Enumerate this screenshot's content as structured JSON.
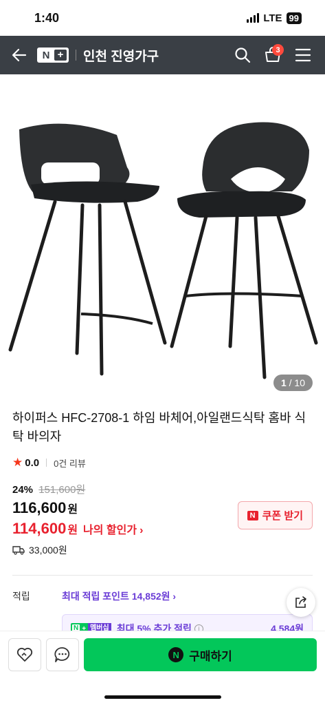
{
  "status_bar": {
    "time": "1:40",
    "network": "LTE",
    "battery": "99"
  },
  "header": {
    "logo_n": "N",
    "logo_plus": "+",
    "store_name": "인천 진영가구",
    "cart_count": "3",
    "icons": [
      "back-arrow-icon",
      "search-icon",
      "cart-icon",
      "menu-icon"
    ]
  },
  "gallery": {
    "current": "1",
    "separator": "/",
    "total": "10"
  },
  "product": {
    "title": "하이퍼스 HFC-2708-1 하임 바체어,아일랜드식탁 홈바 식탁 바의자",
    "rating": "0.0",
    "review_count": "0건 리뷰",
    "discount_rate": "24%",
    "original_price": "151,600원",
    "sale_price": "116,600",
    "won": "원",
    "my_price": "114,600",
    "my_price_label": "나의 할인가",
    "coupon_label": "쿠폰 받기",
    "coupon_badge": "N",
    "delivery_fee": "33,000원"
  },
  "points": {
    "label": "적립",
    "max_points": "최대 적립 포인트 14,852원",
    "membership_badge": "멤버십",
    "membership_text": "최대 5% 추가 적립",
    "membership_amount": "4,584원"
  },
  "bottom_bar": {
    "buy_label": "구매하기",
    "buy_logo": "N"
  },
  "colors": {
    "header_bg": "#3a3f45",
    "accent_green": "#03c75a",
    "price_red": "#e8212e",
    "points_purple": "#6a3cd6"
  }
}
